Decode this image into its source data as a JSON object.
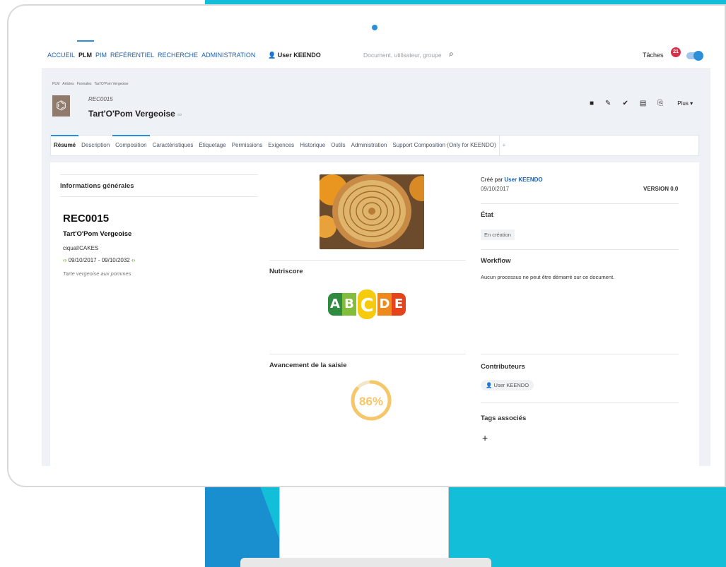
{
  "nav": {
    "items": [
      "ACCUEIL",
      "PLM",
      "PIM",
      "RÉFÉRENTIEL",
      "RECHERCHE",
      "ADMINISTRATION"
    ],
    "active": "PLM",
    "user": "User KEENDO",
    "search_placeholder": "Document, utilisateur, groupe",
    "tasks_label": "Tâches",
    "tasks_count": "21"
  },
  "breadcrumb": [
    "PLM",
    "Articles",
    "Formules",
    "Tart'O'Pom Vergeoise"
  ],
  "document": {
    "code": "REC0015",
    "name": "Tart'O'Pom Vergeoise",
    "more_label": "Plus ▾"
  },
  "tabs": [
    "Résumé",
    "Description",
    "Composition",
    "Caractéristiques",
    "Étiquetage",
    "Permissions",
    "Exigences",
    "Historique",
    "Outils",
    "Administration",
    "Support Composition (Only for KEENDO)",
    "+"
  ],
  "active_tab": "Résumé",
  "general": {
    "title": "Informations générales",
    "ref": "REC0015",
    "name": "Tart'O'Pom Vergeoise",
    "category": "ciqual/CAKES",
    "dates": "09/10/2017 - 09/10/2032",
    "description": "Tarte vergeoise aux pommes"
  },
  "nutriscore": {
    "title": "Nutriscore",
    "letters": [
      "A",
      "B",
      "C",
      "D",
      "E"
    ],
    "selected": "C",
    "colors": [
      "#2e8b3f",
      "#83bd3c",
      "#f6cb0c",
      "#ee8a1d",
      "#e5431b"
    ]
  },
  "progress": {
    "title": "Avancement de la saisie",
    "value_label": "86%",
    "value": 0.86,
    "color": "#f5c76a"
  },
  "meta": {
    "created_by_label": "Créé par",
    "created_by": "User KEENDO",
    "created_date": "09/10/2017",
    "version": "VERSION 0.0"
  },
  "state": {
    "title": "État",
    "value": "En création"
  },
  "workflow": {
    "title": "Workflow",
    "text": "Aucun processus ne peut être démarré sur ce document."
  },
  "contributors": {
    "title": "Contributeurs",
    "user": "User KEENDO"
  },
  "tags": {
    "title": "Tags associés",
    "add": "+"
  }
}
